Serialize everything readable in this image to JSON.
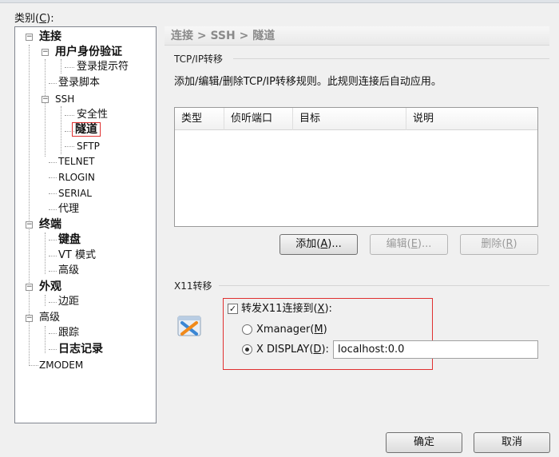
{
  "category_label": "类别(C):",
  "category_label_pre": "类别(",
  "category_label_key": "C",
  "category_label_post": "):",
  "tree": {
    "connection": "连接",
    "user_auth": "用户身份验证",
    "login_prompts": "登录提示符",
    "login_scripts": "登录脚本",
    "ssh": "SSH",
    "security": "安全性",
    "tunnel": "隧道",
    "sftp": "SFTP",
    "telnet": "TELNET",
    "rlogin": "RLOGIN",
    "serial": "SERIAL",
    "proxy": "代理",
    "terminal": "终端",
    "keyboard": "键盘",
    "vt_mode": "VT 模式",
    "advanced_term": "高级",
    "appearance": "外观",
    "margins": "边距",
    "advanced": "高级",
    "trace": "跟踪",
    "logging": "日志记录",
    "zmodem": "ZMODEM"
  },
  "breadcrumb": "连接 > SSH > 隧道",
  "tcpip": {
    "group_title": "TCP/IP转移",
    "description": "添加/编辑/删除TCP/IP转移规则。此规则连接后自动应用。",
    "columns": [
      "类型",
      "侦听端口",
      "目标",
      "说明"
    ],
    "add": {
      "pre": "添加(",
      "key": "A",
      "post": ")..."
    },
    "edit": {
      "pre": "编辑(",
      "key": "E",
      "post": ")..."
    },
    "delete": {
      "pre": "删除(",
      "key": "R",
      "post": ")"
    }
  },
  "x11": {
    "group_title": "X11转移",
    "forward": {
      "pre": "转发X11连接到(",
      "key": "X",
      "post": "):",
      "checked": true
    },
    "xmanager": {
      "pre": "Xmanager(",
      "key": "M",
      "post": ")",
      "selected": false
    },
    "xdisplay": {
      "pre": "X DISPLAY(",
      "key": "D",
      "post": "):",
      "selected": true
    },
    "display_value": "localhost:0.0"
  },
  "buttons": {
    "ok": "确定",
    "cancel": "取消"
  },
  "colors": {
    "highlight_box": "#e03030",
    "breadcrumb_text": "#8a8a8a",
    "xmanager_orange": "#f08a1c",
    "xmanager_blue": "#3a86d4"
  }
}
